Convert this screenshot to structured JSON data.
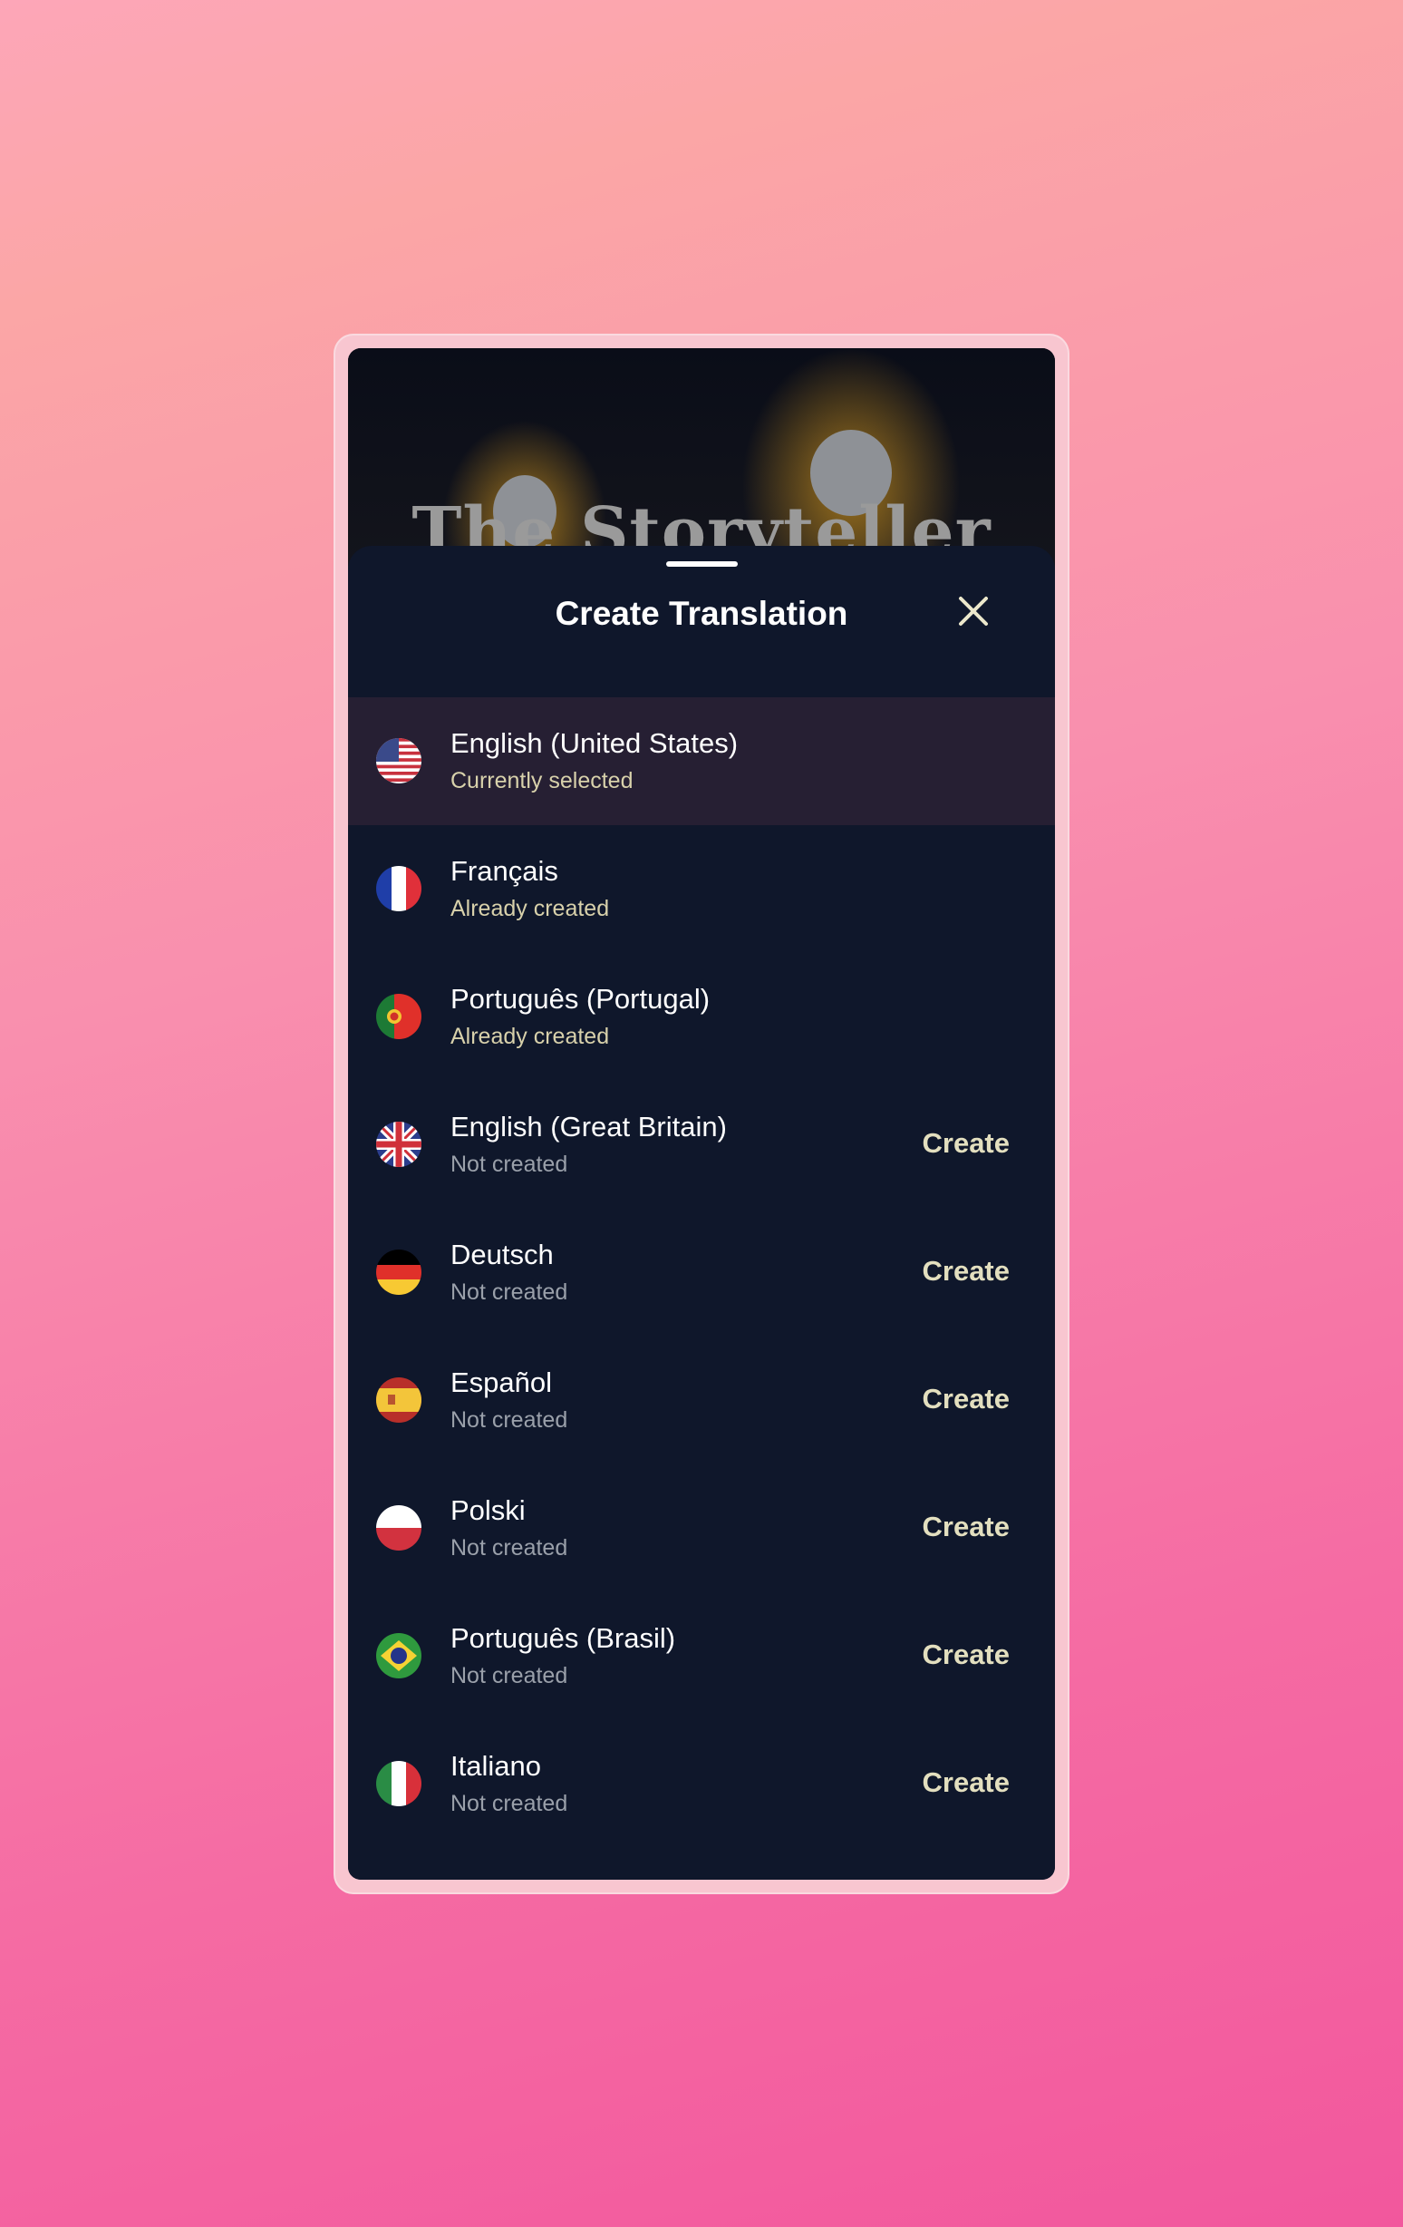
{
  "hero": {
    "title": "The Storyteller"
  },
  "sheet": {
    "title": "Create Translation",
    "close_icon": "close-icon"
  },
  "colors": {
    "sheet_bg": "#0f172b",
    "selected_row_bg": "#261f33",
    "accent": "#e3dfbf"
  },
  "languages": [
    {
      "name": "English (United States)",
      "status": "Currently selected",
      "flag": "us",
      "selected": true
    },
    {
      "name": "Français",
      "status": "Already created",
      "flag": "fr"
    },
    {
      "name": "Português (Portugal)",
      "status": "Already created",
      "flag": "pt"
    },
    {
      "name": "English (Great Britain)",
      "status": "Not created",
      "flag": "gb",
      "action": "Create"
    },
    {
      "name": "Deutsch",
      "status": "Not created",
      "flag": "de",
      "action": "Create"
    },
    {
      "name": "Español",
      "status": "Not created",
      "flag": "es",
      "action": "Create"
    },
    {
      "name": "Polski",
      "status": "Not created",
      "flag": "pl",
      "action": "Create"
    },
    {
      "name": "Português (Brasil)",
      "status": "Not created",
      "flag": "br",
      "action": "Create"
    },
    {
      "name": "Italiano",
      "status": "Not created",
      "flag": "it",
      "action": "Create"
    }
  ]
}
